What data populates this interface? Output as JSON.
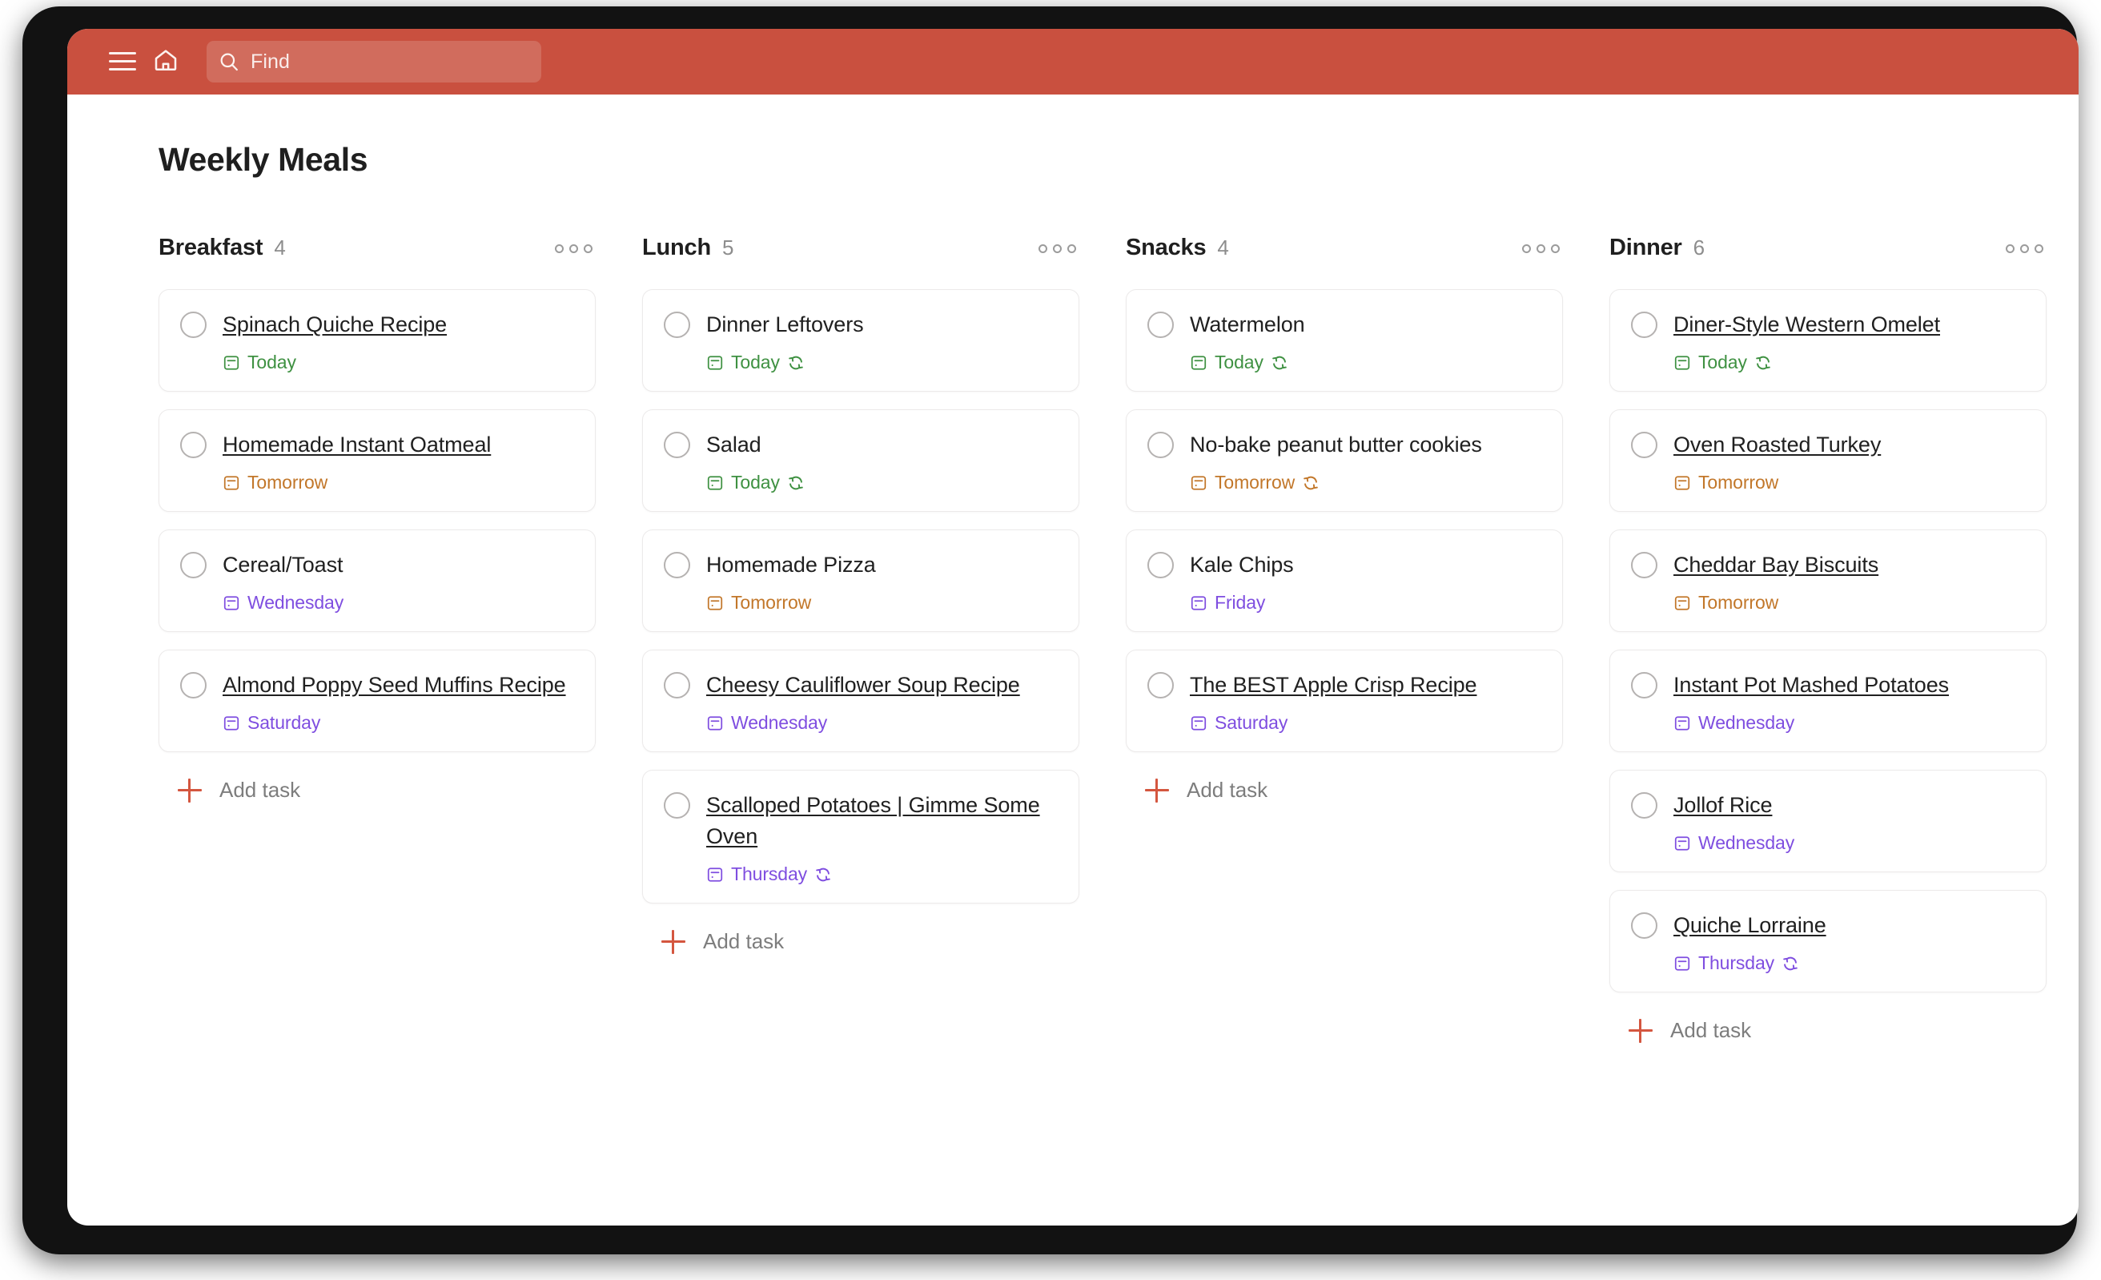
{
  "app_bar": {
    "menu_icon": "hamburger-icon",
    "home_icon": "home-icon",
    "search_icon": "search-icon",
    "search_placeholder": "Find",
    "background_color": "#c9503f"
  },
  "page": {
    "title": "Weekly Meals"
  },
  "colors": {
    "accent": "#c9503f",
    "due_today": "#3f9142",
    "due_tomorrow": "#c2772a",
    "due_later": "#7f4ee0",
    "add_task_plus": "#d4563f"
  },
  "board": {
    "add_task_label": "Add task",
    "columns": [
      {
        "name": "Breakfast",
        "count": "4",
        "menu_icon": "overflow-menu-icon",
        "tasks": [
          {
            "title": "Spinach Quiche Recipe",
            "is_link": true,
            "due": "Today",
            "due_class": "due-today",
            "recurring": false
          },
          {
            "title": "Homemade Instant Oatmeal",
            "is_link": true,
            "due": "Tomorrow",
            "due_class": "due-tomorrow",
            "recurring": false
          },
          {
            "title": "Cereal/Toast",
            "is_link": false,
            "due": "Wednesday",
            "due_class": "due-later",
            "recurring": false
          },
          {
            "title": "Almond Poppy Seed Muffins Recipe",
            "is_link": true,
            "due": "Saturday",
            "due_class": "due-later",
            "recurring": false
          }
        ]
      },
      {
        "name": "Lunch",
        "count": "5",
        "menu_icon": "overflow-menu-icon",
        "tasks": [
          {
            "title": "Dinner Leftovers",
            "is_link": false,
            "due": "Today",
            "due_class": "due-today",
            "recurring": true
          },
          {
            "title": "Salad",
            "is_link": false,
            "due": "Today",
            "due_class": "due-today",
            "recurring": true
          },
          {
            "title": "Homemade Pizza",
            "is_link": false,
            "due": "Tomorrow",
            "due_class": "due-tomorrow",
            "recurring": false
          },
          {
            "title": "Cheesy Cauliflower Soup Recipe",
            "is_link": true,
            "due": "Wednesday",
            "due_class": "due-later",
            "recurring": false
          },
          {
            "title": "Scalloped Potatoes | Gimme Some Oven",
            "is_link": true,
            "due": "Thursday",
            "due_class": "due-later",
            "recurring": true
          }
        ]
      },
      {
        "name": "Snacks",
        "count": "4",
        "menu_icon": "overflow-menu-icon",
        "tasks": [
          {
            "title": "Watermelon",
            "is_link": false,
            "due": "Today",
            "due_class": "due-today",
            "recurring": true
          },
          {
            "title": "No-bake peanut butter cookies",
            "is_link": false,
            "due": "Tomorrow",
            "due_class": "due-tomorrow",
            "recurring": true
          },
          {
            "title": "Kale Chips",
            "is_link": false,
            "due": "Friday",
            "due_class": "due-later",
            "recurring": false
          },
          {
            "title": "The BEST Apple Crisp Recipe",
            "is_link": true,
            "due": "Saturday",
            "due_class": "due-later",
            "recurring": false
          }
        ]
      },
      {
        "name": "Dinner",
        "count": "6",
        "menu_icon": "overflow-menu-icon",
        "tasks": [
          {
            "title": "Diner-Style Western Omelet",
            "is_link": true,
            "due": "Today",
            "due_class": "due-today",
            "recurring": true
          },
          {
            "title": "Oven Roasted Turkey",
            "is_link": true,
            "due": "Tomorrow",
            "due_class": "due-tomorrow",
            "recurring": false
          },
          {
            "title": "Cheddar Bay Biscuits",
            "is_link": true,
            "due": "Tomorrow",
            "due_class": "due-tomorrow",
            "recurring": false
          },
          {
            "title": "Instant Pot Mashed Potatoes",
            "is_link": true,
            "due": "Wednesday",
            "due_class": "due-later",
            "recurring": false
          },
          {
            "title": "Jollof Rice",
            "is_link": true,
            "due": "Wednesday",
            "due_class": "due-later",
            "recurring": false
          },
          {
            "title": "Quiche Lorraine",
            "is_link": true,
            "due": "Thursday",
            "due_class": "due-later",
            "recurring": true
          }
        ]
      }
    ]
  }
}
